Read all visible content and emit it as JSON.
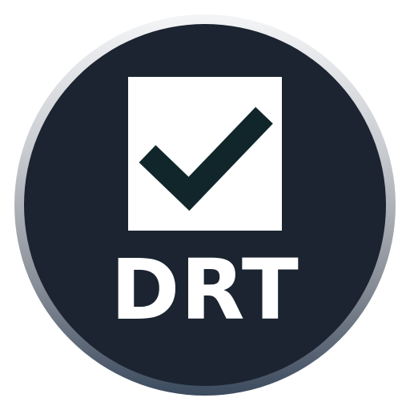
{
  "icon": {
    "name": "drt-checkbox-icon",
    "label": "DRT",
    "glyph": "check-icon",
    "colors": {
      "disc": "#1b2430",
      "box": "#ffffff",
      "check": "#10262a",
      "text": "#ffffff"
    }
  }
}
